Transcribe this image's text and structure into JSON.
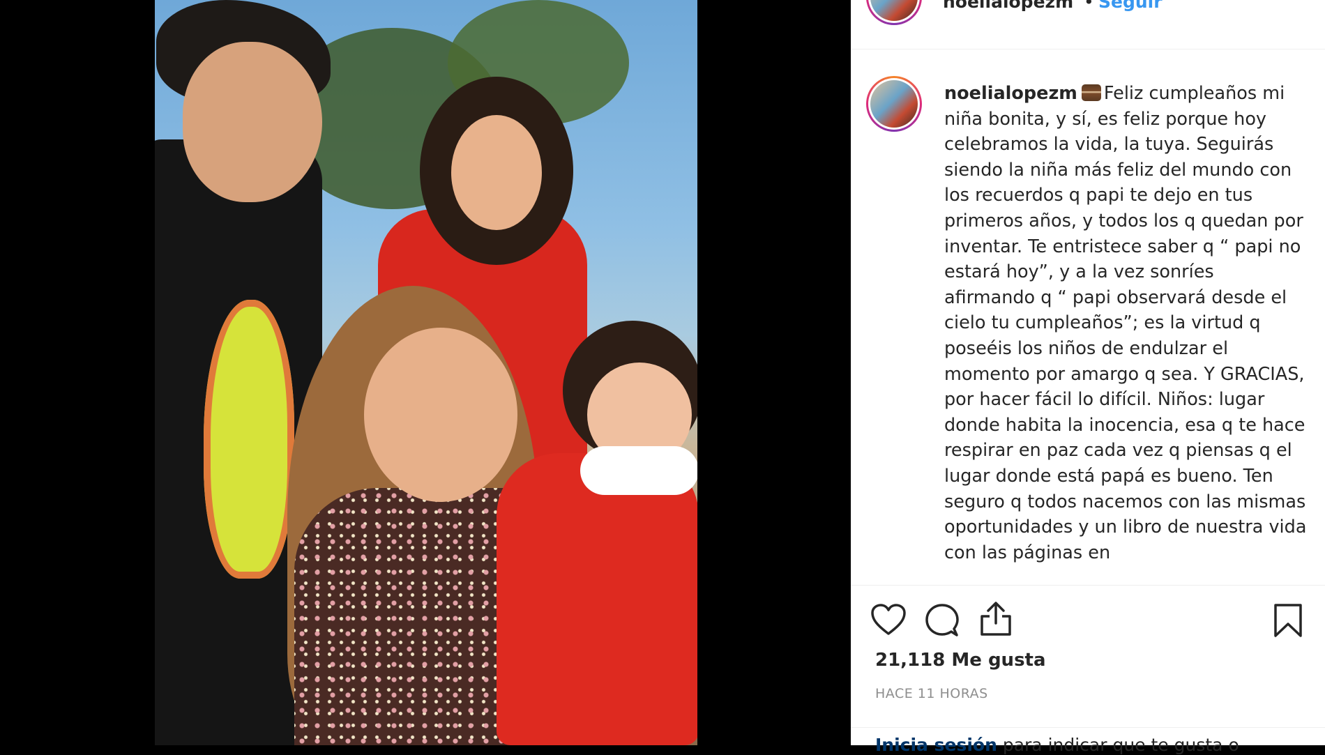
{
  "post": {
    "username": "noelialopezm",
    "header_separator": "•",
    "follow_label": "Seguir",
    "caption_user": "noelialopezm",
    "caption_icon": "birthday-cake-emoji",
    "caption_text": "Feliz cumpleaños mi niña bonita, y sí, es feliz porque hoy celebramos la vida, la tuya. Seguirás siendo la niña más feliz del mundo con los recuerdos q papi te dejo en tus primeros años, y todos los q quedan por inventar. Te entristece saber q “ papi no estará hoy”, y a la vez sonríes afirmando q “ papi observará desde el cielo tu cumpleaños”; es la virtud q poseéis los niños de endulzar el momento por amargo q sea. Y GRACIAS, por hacer fácil lo difícil. Niños: lugar donde habita la inocencia, esa q te hace respirar en paz cada vez q piensas q el lugar donde está papá es bueno. Ten seguro q todos nacemos con las mismas oportunidades y un libro de nuestra vida con las páginas en",
    "likes": "21,118 Me gusta",
    "time_ago": "HACE 11 HORAS",
    "login_link": "Inicia sesión",
    "login_text": " para indicar que te gusta o"
  },
  "icons": [
    "heart-icon",
    "comment-icon",
    "share-icon",
    "bookmark-icon"
  ],
  "colors": {
    "follow": "#3897f0",
    "link": "#003569",
    "muted": "#8e8e8e"
  }
}
